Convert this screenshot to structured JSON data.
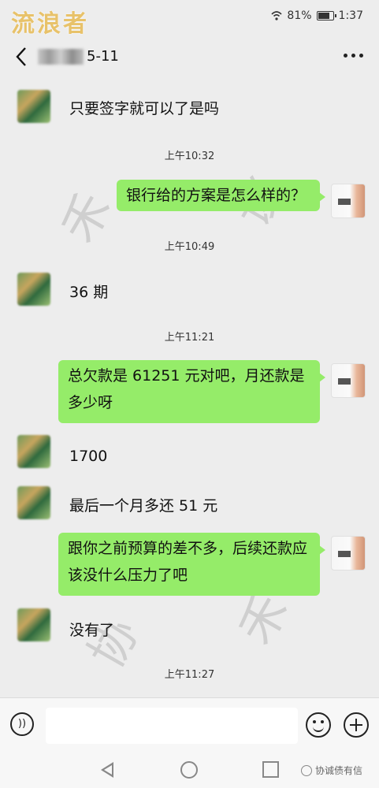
{
  "status_bar": {
    "watermark": "流浪者",
    "battery": "81%",
    "time": "1:37"
  },
  "header": {
    "title": "5-11"
  },
  "messages": [
    {
      "side": "left",
      "text": "只要签字就可以了是吗"
    },
    {
      "type": "time",
      "text": "上午10:32"
    },
    {
      "side": "right",
      "text": "银行给的方案是怎么样的？"
    },
    {
      "type": "time",
      "text": "上午10:49"
    },
    {
      "side": "left",
      "text": "36 期"
    },
    {
      "type": "time",
      "text": "上午11:21"
    },
    {
      "side": "right",
      "text": "总欠款是 61251 元对吧，月还款是多少呀"
    },
    {
      "side": "left",
      "text": "1700"
    },
    {
      "side": "left",
      "text": "最后一个月多还 51 元"
    },
    {
      "side": "right",
      "text": "跟你之前预算的差不多，后续还款应该没什么压力了吧"
    },
    {
      "side": "left",
      "text": "没有了"
    },
    {
      "type": "time",
      "text": "上午11:27"
    }
  ],
  "input_bar": {
    "placeholder": "",
    "voice_icon": "voice-icon",
    "emoji_icon": "emoji-icon",
    "plus_icon": "plus-icon"
  },
  "nav_watermark": "协诚债有信",
  "colors": {
    "bubble_right": "#95ec69",
    "background": "#ededed"
  }
}
